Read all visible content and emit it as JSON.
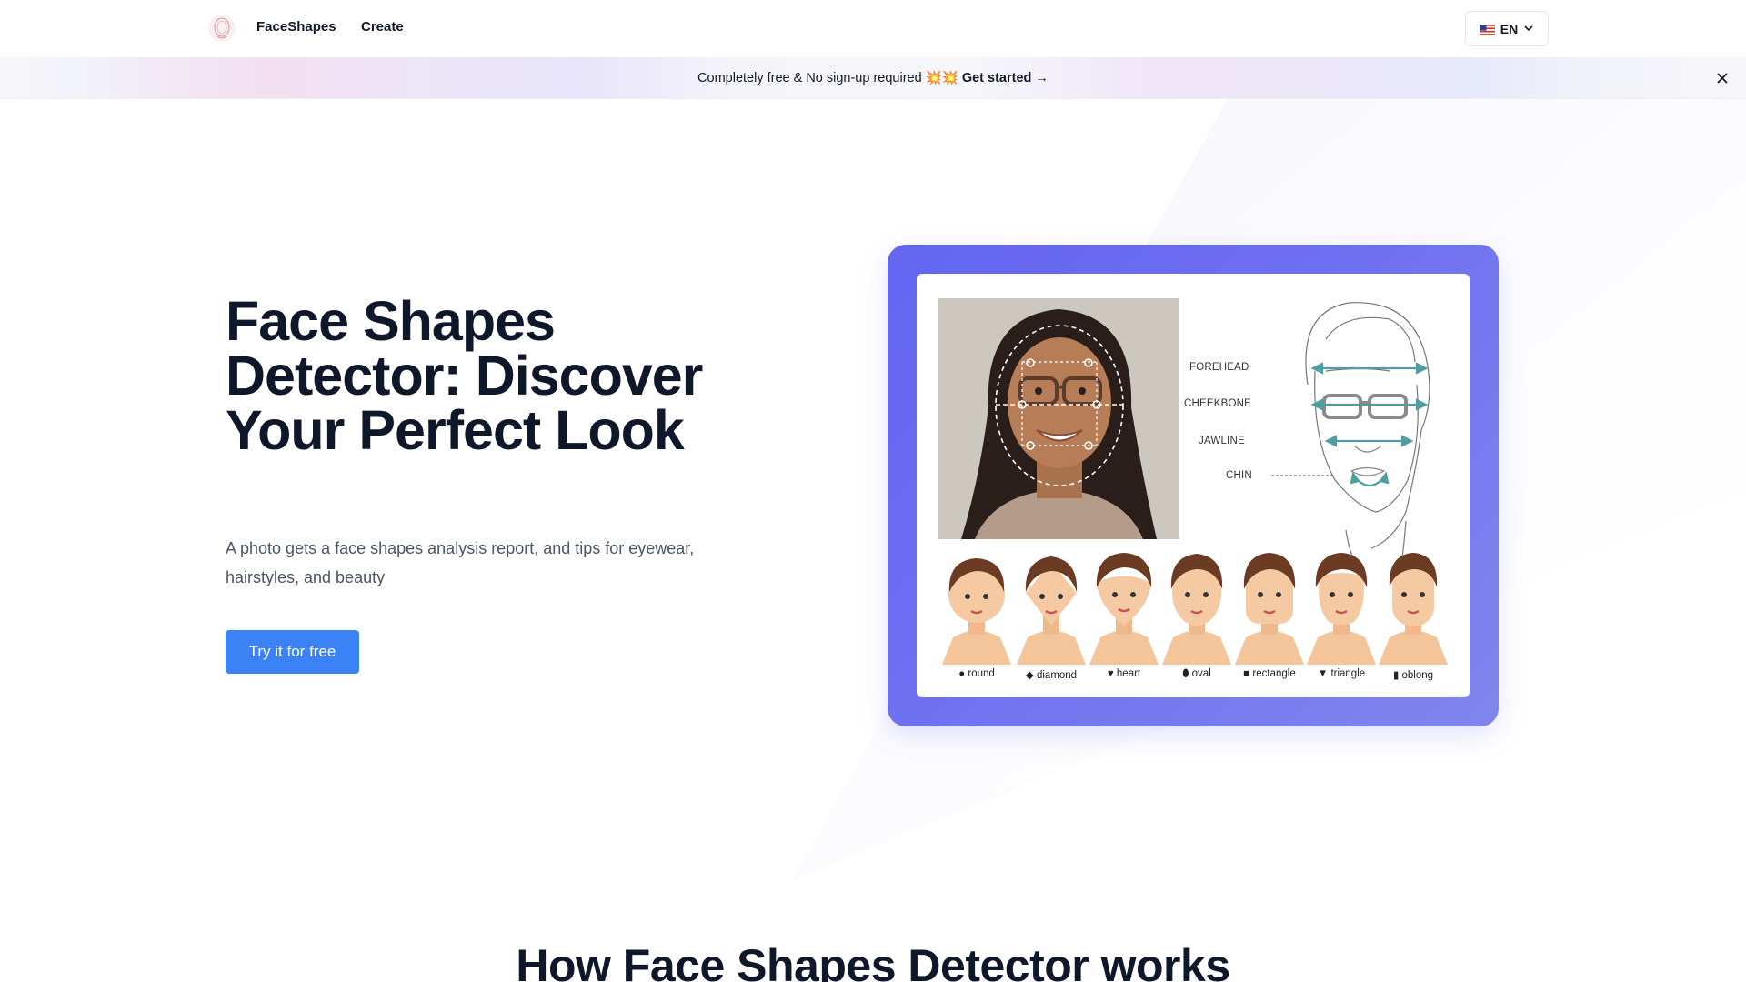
{
  "nav": {
    "brand": "FaceShapes",
    "create": "Create",
    "language": "EN",
    "logo_icon": "face-logo-icon"
  },
  "banner": {
    "text": "Completely free & No sign-up required 💥💥",
    "cta": "Get started →"
  },
  "hero": {
    "title": "Face Shapes Detector: Discover Your Perfect Look",
    "subtitle": "A photo gets a face shapes analysis report, and tips for eyewear, hairstyles, and beauty",
    "cta": "Try it for free"
  },
  "illustration": {
    "labels": [
      "FOREHEAD",
      "CHEEKBONE",
      "JAWLINE",
      "CHIN"
    ],
    "shapes": [
      "round",
      "diamond",
      "heart",
      "oval",
      "rectangle",
      "triangle",
      "oblong"
    ]
  },
  "section": {
    "title": "How Face Shapes Detector works"
  },
  "colors": {
    "accent": "#3b82f6",
    "card": "#6366f1",
    "title": "#0f172a"
  }
}
